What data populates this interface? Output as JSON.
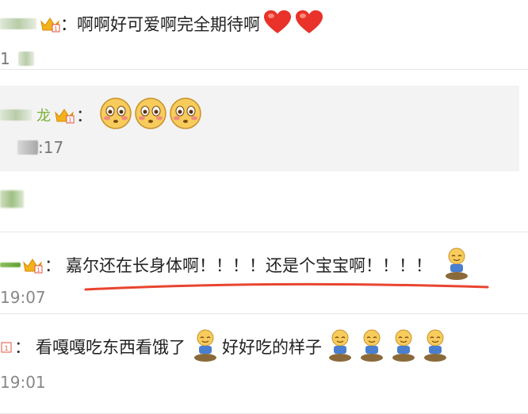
{
  "comments": [
    {
      "text": "：啊啊好可爱啊完全期待啊",
      "time": "1"
    },
    {
      "name_suffix": "龙",
      "colon": "：",
      "time": ":17"
    },
    {
      "colon": "：",
      "text": "嘉尔还在长身体啊！！！！还是个宝宝啊！！！！",
      "time": "19:07"
    },
    {
      "colon": "：",
      "text_a": "看嘎嘎吃东西看饿了",
      "text_b": "好好吃的样子",
      "time": "19:01"
    }
  ],
  "colors": {
    "name_green": "#7ab035",
    "underline_red": "#e8452f",
    "nested_bg": "#f3f3f3",
    "divider": "#e6e6e6"
  },
  "icons": [
    "crown-badge-icon",
    "heart-emoji-icon",
    "blushing-face-emoji-icon",
    "sitting-figure-emoji-icon"
  ]
}
